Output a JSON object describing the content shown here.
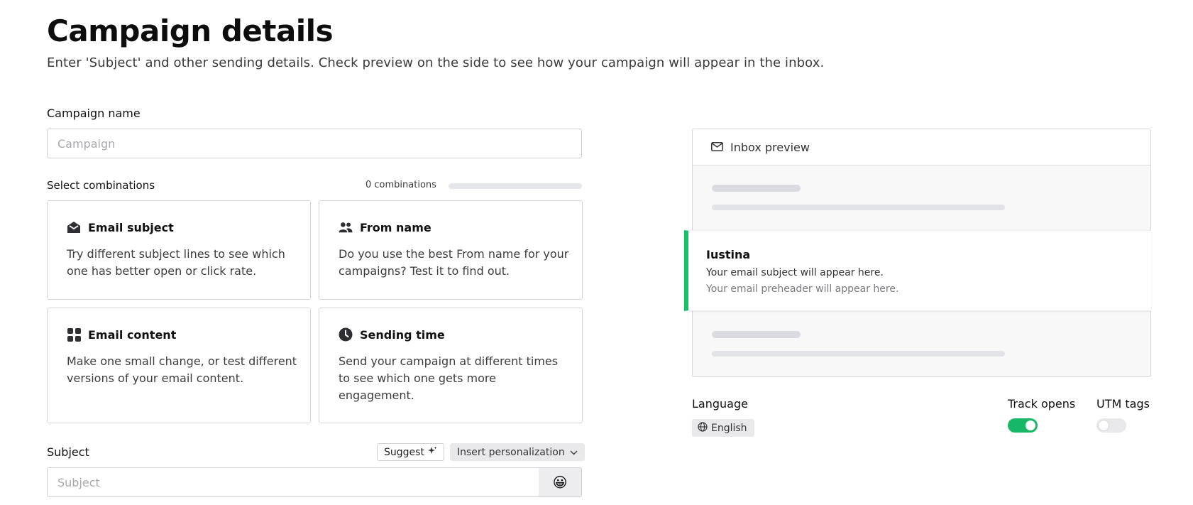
{
  "header": {
    "title": "Campaign details",
    "subtitle": "Enter 'Subject' and other sending details. Check preview on the side to see how your campaign will appear in the inbox."
  },
  "campaign_name": {
    "label": "Campaign name",
    "placeholder": "Campaign",
    "value": ""
  },
  "combinations": {
    "label": "Select combinations",
    "count_text": "0 combinations",
    "progress": 0,
    "cards": [
      {
        "icon": "envelope-open-icon",
        "title": "Email subject",
        "description": "Try different subject lines to see which one has better open or click rate."
      },
      {
        "icon": "users-icon",
        "title": "From name",
        "description": "Do you use the best From name for your campaigns? Test it to find out."
      },
      {
        "icon": "grid-icon",
        "title": "Email content",
        "description": "Make one small change, or test different versions of your email content."
      },
      {
        "icon": "clock-icon",
        "title": "Sending time",
        "description": "Send your campaign at different times to see which one gets more engagement."
      }
    ]
  },
  "subject": {
    "label": "Subject",
    "placeholder": "Subject",
    "value": "",
    "suggest_label": "Suggest",
    "personalize_label": "Insert personalization",
    "emoji": "😀"
  },
  "preview": {
    "title": "Inbox preview",
    "from_name": "Iustina",
    "subject_placeholder": "Your email subject will appear here.",
    "preheader_placeholder": "Your email preheader will appear here.",
    "accent_color": "#16c06b"
  },
  "settings": {
    "language_label": "Language",
    "language_value": "English",
    "track_opens_label": "Track opens",
    "track_opens_on": true,
    "utm_tags_label": "UTM tags",
    "utm_tags_on": false
  }
}
